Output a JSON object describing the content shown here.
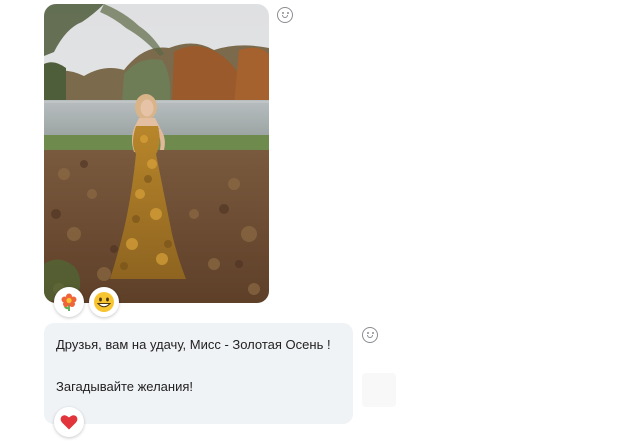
{
  "photo_message": {
    "image_icon": "woman-in-autumn-leaf-dress-photo",
    "reactions": [
      {
        "icon": "flower-emoji-icon"
      },
      {
        "icon": "grinning-face-emoji-icon"
      }
    ]
  },
  "text_message": {
    "line1": "Друзья, вам на удачу, Мисс - Золотая Осень !",
    "line2": "Загадывайте желания!",
    "reactions": [
      {
        "icon": "heart-emoji-icon"
      }
    ]
  },
  "colors": {
    "bubble_bg": "#f0f3f6",
    "heart": "#e2353b",
    "emoji_yellow": "#f7c531"
  }
}
